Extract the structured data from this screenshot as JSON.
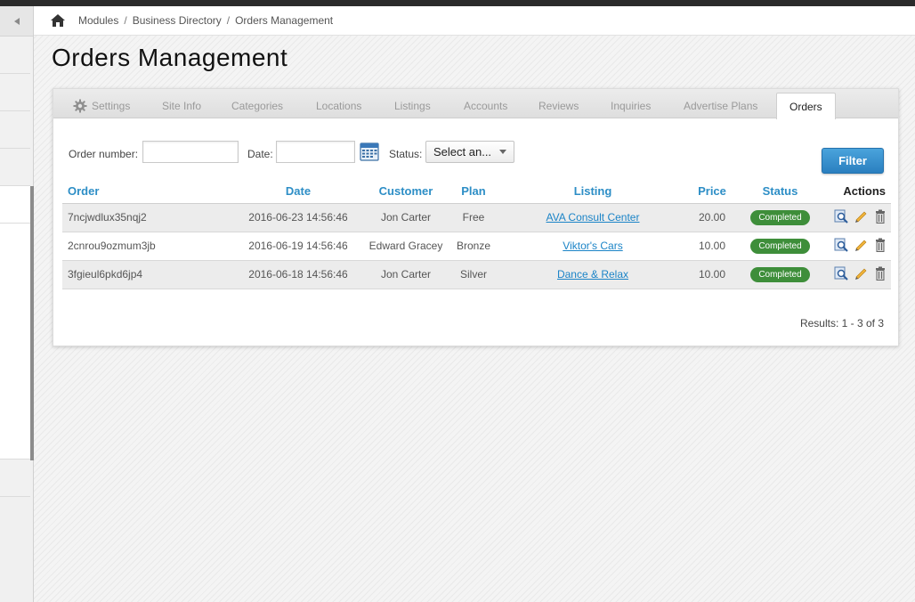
{
  "breadcrumb": {
    "items": [
      "Modules",
      "Business Directory",
      "Orders Management"
    ],
    "separator": "/"
  },
  "page": {
    "title": "Orders Management"
  },
  "tabs": [
    {
      "label": "Settings",
      "icon": "gear-icon"
    },
    {
      "label": "Site Info"
    },
    {
      "label": "Categories"
    },
    {
      "label": "Locations"
    },
    {
      "label": "Listings"
    },
    {
      "label": "Accounts"
    },
    {
      "label": "Reviews"
    },
    {
      "label": "Inquiries"
    },
    {
      "label": "Advertise Plans"
    },
    {
      "label": "Orders",
      "active": true
    }
  ],
  "filters": {
    "order_number_label": "Order number:",
    "order_number_value": "",
    "date_label": "Date:",
    "date_value": "",
    "status_label": "Status:",
    "status_selected": "Select an...",
    "filter_button": "Filter"
  },
  "table": {
    "columns": [
      "Order",
      "Date",
      "Customer",
      "Plan",
      "Listing",
      "Price",
      "Status",
      "Actions"
    ],
    "rows": [
      {
        "order": "7ncjwdlux35nqj2",
        "date": "2016-06-23 14:56:46",
        "customer": "Jon Carter",
        "plan": "Free",
        "listing": "AVA Consult Center",
        "price": "20.00",
        "status": "Completed"
      },
      {
        "order": "2cnrou9ozmum3jb",
        "date": "2016-06-19 14:56:46",
        "customer": "Edward Gracey",
        "plan": "Bronze",
        "listing": "Viktor's Cars",
        "price": "10.00",
        "status": "Completed"
      },
      {
        "order": "3fgieul6pkd6jp4",
        "date": "2016-06-18 14:56:46",
        "customer": "Jon Carter",
        "plan": "Silver",
        "listing": "Dance & Relax",
        "price": "10.00",
        "status": "Completed"
      }
    ]
  },
  "results_text": "Results: 1 - 3 of 3",
  "colors": {
    "accent": "#2d8ec6",
    "status_completed": "#3e8e3a",
    "filter_button": "#2a7fbf"
  }
}
